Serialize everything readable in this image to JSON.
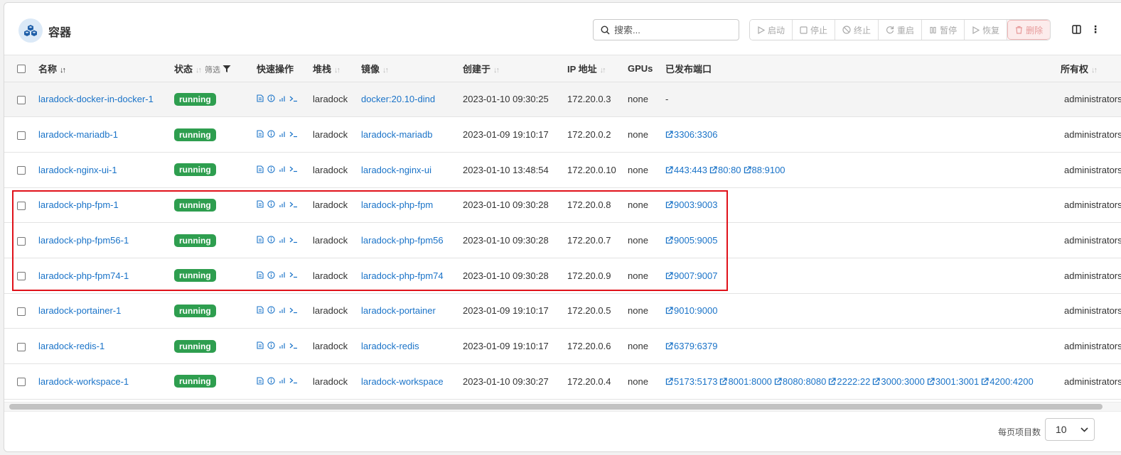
{
  "header": {
    "title": "容器",
    "search_placeholder": "搜索...",
    "actions": [
      {
        "label": "启动",
        "icon": "play-icon"
      },
      {
        "label": "停止",
        "icon": "stop-icon"
      },
      {
        "label": "终止",
        "icon": "ban-icon"
      },
      {
        "label": "重启",
        "icon": "refresh-icon"
      },
      {
        "label": "暂停",
        "icon": "pause-icon"
      },
      {
        "label": "恢复",
        "icon": "resume-icon"
      },
      {
        "label": "删除",
        "icon": "trash-icon"
      }
    ]
  },
  "table": {
    "columns": {
      "name": "名称",
      "state": "状态",
      "filter": "筛选",
      "quick": "快速操作",
      "stack": "堆栈",
      "image": "镜像",
      "created": "创建于",
      "ip": "IP 地址",
      "gpus": "GPUs",
      "ports": "已发布端口",
      "owner": "所有权"
    },
    "rows": [
      {
        "name": "laradock-docker-in-docker-1",
        "state": "running",
        "stack": "laradock",
        "image": "docker:20.10-dind",
        "created": "2023-01-10 09:30:25",
        "ip": "172.20.0.3",
        "gpus": "none",
        "ports": [
          "-"
        ],
        "owner": "administrators"
      },
      {
        "name": "laradock-mariadb-1",
        "state": "running",
        "stack": "laradock",
        "image": "laradock-mariadb",
        "created": "2023-01-09 19:10:17",
        "ip": "172.20.0.2",
        "gpus": "none",
        "ports": [
          "3306:3306"
        ],
        "owner": "administrators"
      },
      {
        "name": "laradock-nginx-ui-1",
        "state": "running",
        "stack": "laradock",
        "image": "laradock-nginx-ui",
        "created": "2023-01-10 13:48:54",
        "ip": "172.20.0.10",
        "gpus": "none",
        "ports": [
          "443:443",
          "80:80",
          "88:9100"
        ],
        "owner": "administrators"
      },
      {
        "name": "laradock-php-fpm-1",
        "state": "running",
        "stack": "laradock",
        "image": "laradock-php-fpm",
        "created": "2023-01-10 09:30:28",
        "ip": "172.20.0.8",
        "gpus": "none",
        "ports": [
          "9003:9003"
        ],
        "owner": "administrators"
      },
      {
        "name": "laradock-php-fpm56-1",
        "state": "running",
        "stack": "laradock",
        "image": "laradock-php-fpm56",
        "created": "2023-01-10 09:30:28",
        "ip": "172.20.0.7",
        "gpus": "none",
        "ports": [
          "9005:9005"
        ],
        "owner": "administrators"
      },
      {
        "name": "laradock-php-fpm74-1",
        "state": "running",
        "stack": "laradock",
        "image": "laradock-php-fpm74",
        "created": "2023-01-10 09:30:28",
        "ip": "172.20.0.9",
        "gpus": "none",
        "ports": [
          "9007:9007"
        ],
        "owner": "administrators"
      },
      {
        "name": "laradock-portainer-1",
        "state": "running",
        "stack": "laradock",
        "image": "laradock-portainer",
        "created": "2023-01-09 19:10:17",
        "ip": "172.20.0.5",
        "gpus": "none",
        "ports": [
          "9010:9000"
        ],
        "owner": "administrators"
      },
      {
        "name": "laradock-redis-1",
        "state": "running",
        "stack": "laradock",
        "image": "laradock-redis",
        "created": "2023-01-09 19:10:17",
        "ip": "172.20.0.6",
        "gpus": "none",
        "ports": [
          "6379:6379"
        ],
        "owner": "administrators"
      },
      {
        "name": "laradock-workspace-1",
        "state": "running",
        "stack": "laradock",
        "image": "laradock-workspace",
        "created": "2023-01-10 09:30:27",
        "ip": "172.20.0.4",
        "gpus": "none",
        "ports": [
          "5173:5173",
          "8001:8000",
          "8080:8080",
          "2222:22",
          "3000:3000",
          "3001:3001",
          "4200:4200"
        ],
        "owner": "administrators"
      }
    ]
  },
  "footer": {
    "per_page_label": "每页项目数",
    "per_page_value": "10"
  },
  "colors": {
    "accent": "#1a73c8",
    "running": "#2e9e4f",
    "highlight": "#e0111a"
  }
}
